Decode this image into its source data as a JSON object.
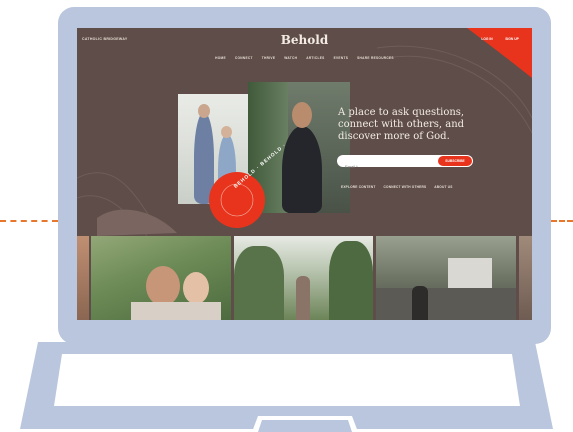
{
  "site": {
    "top_left_label": "CATHOLIC BRIDGEWAY",
    "logo": "Behold",
    "nav": [
      "HOME",
      "CONNECT",
      "THRIVE",
      "WATCH",
      "ARTICLES",
      "EVENTS",
      "SHARE RESOURCES"
    ],
    "login_label": "LOG IN",
    "signup_label": "SIGN UP"
  },
  "hero": {
    "tagline": "A place to ask questions, connect with others, and discover more of God.",
    "email_placeholder": "Email *",
    "subscribe_label": "SUBSCRIBE",
    "links": [
      "EXPLORE CONTENT",
      "CONNECT WITH OTHERS",
      "ABOUT US"
    ],
    "badge_text": "BEHOLD · BEHOLD ·"
  },
  "colors": {
    "accent": "#e8341d",
    "background": "#5e4d49",
    "laptop": "#b9c6dd",
    "dash": "#e8772e"
  }
}
